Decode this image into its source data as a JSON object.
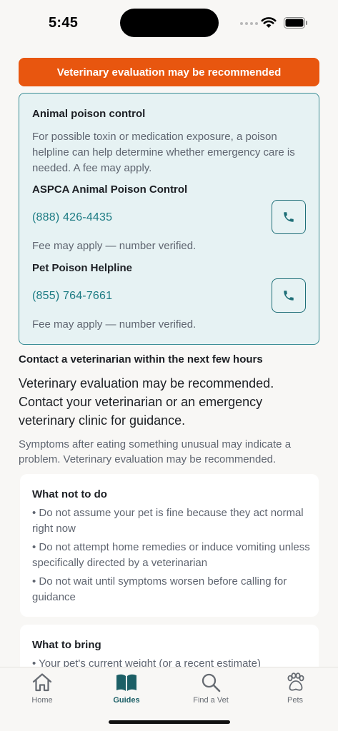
{
  "status": {
    "time": "5:45"
  },
  "banner": {
    "text": "Veterinary evaluation may be recommended"
  },
  "poison": {
    "title": "Animal poison control",
    "description": "For possible toxin or medication exposure, a poison helpline can help determine whether emergency care is needed. A fee may apply.",
    "lines": [
      {
        "name": "ASPCA Animal Poison Control",
        "phone": "(888) 426-4435",
        "note": "Fee may apply — number verified."
      },
      {
        "name": "Pet Poison Helpline",
        "phone": "(855) 764-7661",
        "note": "Fee may apply — number verified."
      }
    ]
  },
  "contact": {
    "heading": "Contact a veterinarian within the next few hours",
    "body": "Veterinary evaluation may be recommended. Contact your veterinarian or an emergency veterinary clinic for guidance.",
    "sub": "Symptoms after eating something unusual may indicate a problem. Veterinary evaluation may be recommended."
  },
  "what_not_to_do": {
    "title": "What not to do",
    "items": [
      "• Do not assume your pet is fine because they act normal right now",
      "• Do not attempt home remedies or induce vomiting unless specifically directed by a veterinarian",
      "• Do not wait until symptoms worsen before calling for guidance"
    ]
  },
  "what_to_bring": {
    "title": "What to bring",
    "items": [
      "• Your pet's current weight (or a recent estimate)"
    ]
  },
  "tabs": [
    {
      "label": "Home",
      "icon": "house-icon",
      "active": false
    },
    {
      "label": "Guides",
      "icon": "book-icon",
      "active": true
    },
    {
      "label": "Find a Vet",
      "icon": "magnifier-icon",
      "active": false
    },
    {
      "label": "Pets",
      "icon": "paw-icon",
      "active": false
    }
  ],
  "colors": {
    "accent": "#e8560f",
    "teal": "#1c7b83",
    "teal_border": "#3a8d95",
    "card_bg": "#e6f2f3"
  }
}
